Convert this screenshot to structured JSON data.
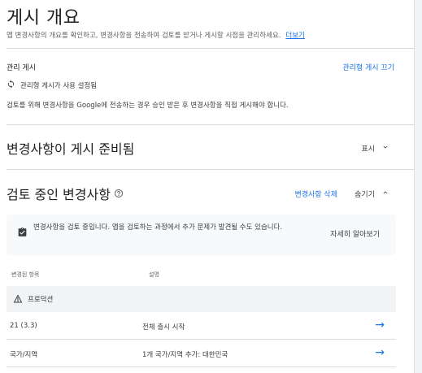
{
  "header": {
    "title": "게시 개요",
    "subtitle": "앱 변경사항의 개요를 확인하고, 변경사항을 전송하여 검토를 받거나 게시할 시점을 관리하세요.",
    "subtitle_link": "더보기"
  },
  "managed": {
    "label": "관리 게시",
    "off_link": "관리형 게시 끄기",
    "status": "관리형 게시가 사용 설정됨",
    "description": "검토를 위해 변경사항을 Google에 전송하는 경우 승인 받은 후 변경사항을 직접 게시해야 합니다."
  },
  "ready": {
    "title": "변경사항이 게시 준비됨",
    "toggle": "표시"
  },
  "review": {
    "title": "검토 중인 변경사항",
    "delete_link": "변경사항 삭제",
    "toggle": "숨기기",
    "info_text": "변경사항을 검토 중입니다. 앱을 검토하는 과정에서 추가 문제가 발견될 수도 있습니다.",
    "info_link": "자세히 알아보기",
    "columns": [
      "변경된 항목",
      "설명"
    ],
    "group": "프로덕션",
    "rows": [
      {
        "item": "21 (3.3)",
        "description": "전체 출시 시작"
      },
      {
        "item": "국가/지역",
        "description": "1개 국가/지역 추가: 대한민국"
      }
    ]
  },
  "icons": {
    "sync": "sync-icon",
    "help": "help-icon",
    "clipboard": "clipboard-icon",
    "production": "production-icon",
    "arrow": "arrow-right-icon"
  },
  "colors": {
    "accent": "#1a73e8",
    "text": "#202124",
    "muted": "#5f6368"
  }
}
